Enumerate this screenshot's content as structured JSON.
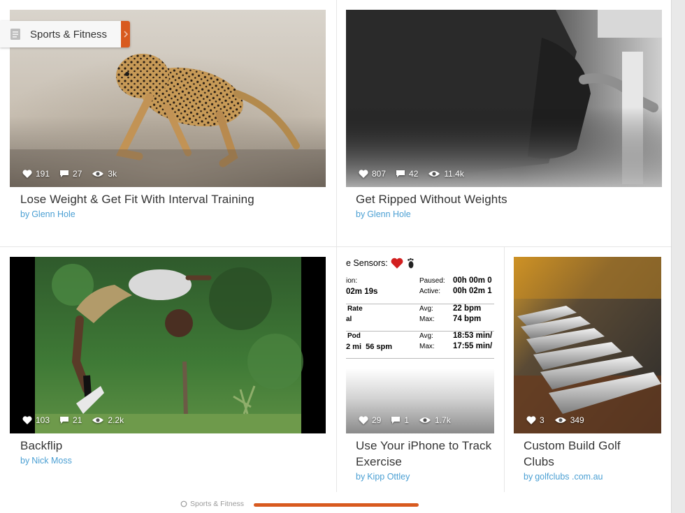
{
  "category_tag": {
    "label": "Sports & Fitness",
    "icon": "document-icon",
    "accent": "#d85a1f"
  },
  "cards": [
    {
      "title": "Lose Weight & Get Fit With Interval Training",
      "by": "by",
      "author": "Glenn Hole",
      "likes": "191",
      "comments": "27",
      "views": "3k"
    },
    {
      "title": "Get Ripped Without Weights",
      "by": "by",
      "author": "Glenn Hole",
      "likes": "807",
      "comments": "42",
      "views": "11.4k"
    },
    {
      "title": "Backflip",
      "by": "by",
      "author": "Nick Moss",
      "likes": "103",
      "comments": "21",
      "views": "2.2k"
    },
    {
      "title": "Use Your iPhone to Track Exercise",
      "by": "by",
      "author": "Kipp Ottley",
      "likes": "29",
      "comments": "1",
      "views": "1.7k"
    },
    {
      "title": "Custom Build Golf Clubs",
      "by": "by",
      "author": "golfclubs .com.au",
      "likes": "3",
      "views": "349"
    }
  ],
  "iphone_screen": {
    "header": "e Sensors:",
    "rows": [
      {
        "left": "ion:",
        "left2": "02m 19s",
        "k1": "Paused:",
        "v1": "00h 00m 0",
        "k2": "Active:",
        "v2": "00h 02m 1"
      },
      {
        "left": "Rate",
        "left2": "al",
        "k1": "Avg:",
        "v1": "22 bpm",
        "k2": "Max:",
        "v2": "74 bpm"
      },
      {
        "left": "Pod",
        "left2": "2 mi  56 spm",
        "k1": "Avg:",
        "v1": "18:53 min/",
        "k2": "Max:",
        "v2": "17:55 min/"
      }
    ]
  },
  "footer": {
    "label": "Sports & Fitness",
    "accent": "#d85a1f"
  }
}
